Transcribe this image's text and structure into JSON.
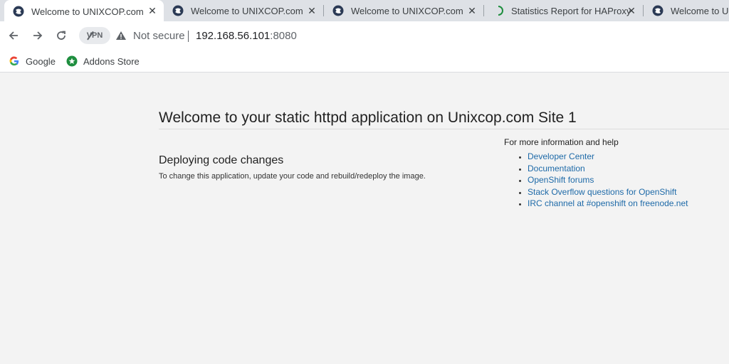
{
  "tabs": [
    {
      "title": "Welcome to UNIXCOP.com",
      "icon": "unixcop-favicon-icon",
      "active": true
    },
    {
      "title": "Welcome to UNIXCOP.com",
      "icon": "unixcop-favicon-icon",
      "active": false
    },
    {
      "title": "Welcome to UNIXCOP.com",
      "icon": "unixcop-favicon-icon",
      "active": false
    },
    {
      "title": "Statistics Report for HAProxy",
      "icon": "loading-spinner-icon",
      "active": false
    },
    {
      "title": "Welcome to UNIXCOP.com",
      "icon": "unixcop-favicon-icon",
      "active": false
    }
  ],
  "toolbar": {
    "vpn_label": "VPN",
    "security_text": "Not secure",
    "url_host": "192.168.56.101",
    "url_port": ":8080"
  },
  "bookmarks": [
    {
      "label": "Google",
      "icon": "google-icon"
    },
    {
      "label": "Addons Store",
      "icon": "addons-store-icon"
    }
  ],
  "page": {
    "title": "Welcome to your static httpd application on Unixcop.com Site 1",
    "section_heading": "Deploying code changes",
    "section_text": "To change this application, update your code and rebuild/redeploy the image.",
    "help_heading": "For more information and help",
    "help_links": [
      "Developer Center",
      "Documentation",
      "OpenShift forums",
      "Stack Overflow questions for OpenShift",
      "IRC channel at #openshift on freenode.net"
    ]
  },
  "colors": {
    "tabstrip_bg": "#dee1e6",
    "page_bg": "#f3f3f3",
    "link": "#1e6aa8",
    "favicon": "#2b3a55"
  }
}
